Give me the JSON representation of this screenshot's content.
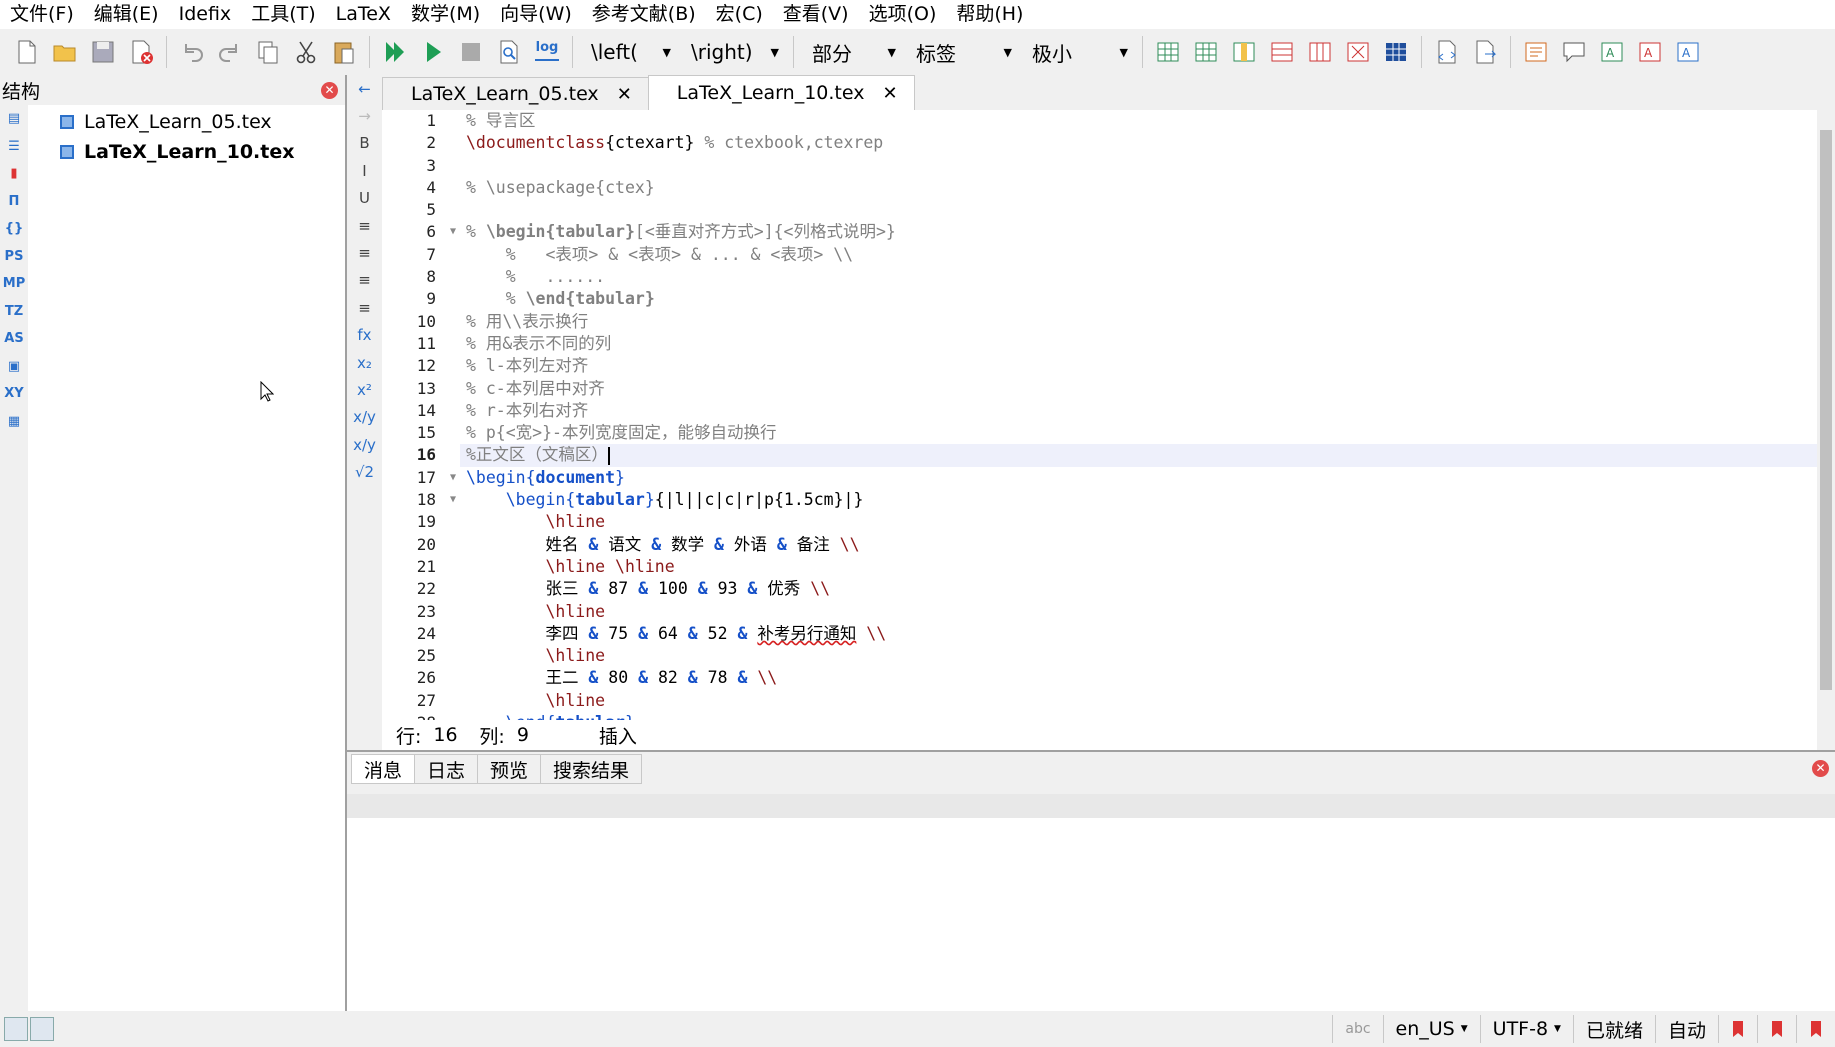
{
  "menu": [
    "文件(F)",
    "编辑(E)",
    "Idefix",
    "工具(T)",
    "LaTeX",
    "数学(M)",
    "向导(W)",
    "参考文献(B)",
    "宏(C)",
    "查看(V)",
    "选项(O)",
    "帮助(H)"
  ],
  "toolbar": {
    "left_delim": "\\left(",
    "right_delim": "\\right)",
    "section_combo": "部分",
    "label_combo": "标签",
    "size_combo": "极小",
    "log_label": "log"
  },
  "sidebar": {
    "title": "结构",
    "icons": [
      "structure-icon",
      "toc-icon",
      "bookmark-icon",
      "symbols-icon",
      "brackets-icon",
      "PS",
      "MP",
      "TZ",
      "AS",
      "picture-icon",
      "XY",
      "block-icon"
    ],
    "files": [
      {
        "name": "LaTeX_Learn_05.tex",
        "active": false
      },
      {
        "name": "LaTeX_Learn_10.tex",
        "active": true
      }
    ]
  },
  "editor_strip": [
    "B",
    "I",
    "U",
    "fx",
    "x₂",
    "x²",
    "x/y",
    "x/y",
    "√2"
  ],
  "tabs": [
    {
      "label": "LaTeX_Learn_05.tex",
      "active": false
    },
    {
      "label": "LaTeX_Learn_10.tex",
      "active": true
    }
  ],
  "code": {
    "current_line": 16,
    "folds": [
      6,
      17,
      18
    ],
    "lines": [
      "% 导言区",
      "\\documentclass{ctexart} % ctexbook,ctexrep",
      "",
      "% \\usepackage{ctex}",
      "",
      "% \\begin{tabular}[<垂直对齐方式>]{<列格式说明>}",
      "    %   <表项> & <表项> & ... & <表项> \\\\",
      "    %   ......",
      "    % \\end{tabular}",
      "% 用\\\\表示换行",
      "% 用&表示不同的列",
      "% l-本列左对齐",
      "% c-本列居中对齐",
      "% r-本列右对齐",
      "% p{<宽>}-本列宽度固定，能够自动换行",
      "%正文区（文稿区）",
      "\\begin{document}",
      "    \\begin{tabular}{|l||c|c|r|p{1.5cm}|}",
      "        \\hline",
      "        姓名 & 语文 & 数学 & 外语 & 备注 \\\\",
      "        \\hline \\hline",
      "        张三 & 87 & 100 & 93 & 优秀 \\\\",
      "        \\hline",
      "        李四 & 75 & 64 & 52 & 补考另行通知 \\\\",
      "        \\hline",
      "        王二 & 80 & 82 & 78 & \\\\",
      "        \\hline",
      "    \\end{tabular}"
    ]
  },
  "status_line": {
    "row_label": "行:",
    "row": "16",
    "col_label": "列:",
    "col": "9",
    "mode": "插入"
  },
  "bottom_tabs": [
    {
      "label": "消息",
      "active": true
    },
    {
      "label": "日志",
      "active": false
    },
    {
      "label": "预览",
      "active": false
    },
    {
      "label": "搜索结果",
      "active": false
    }
  ],
  "statusbar": {
    "spell": "abc",
    "language": "en_US",
    "encoding": "UTF-8",
    "ready": "已就绪",
    "auto": "自动"
  }
}
